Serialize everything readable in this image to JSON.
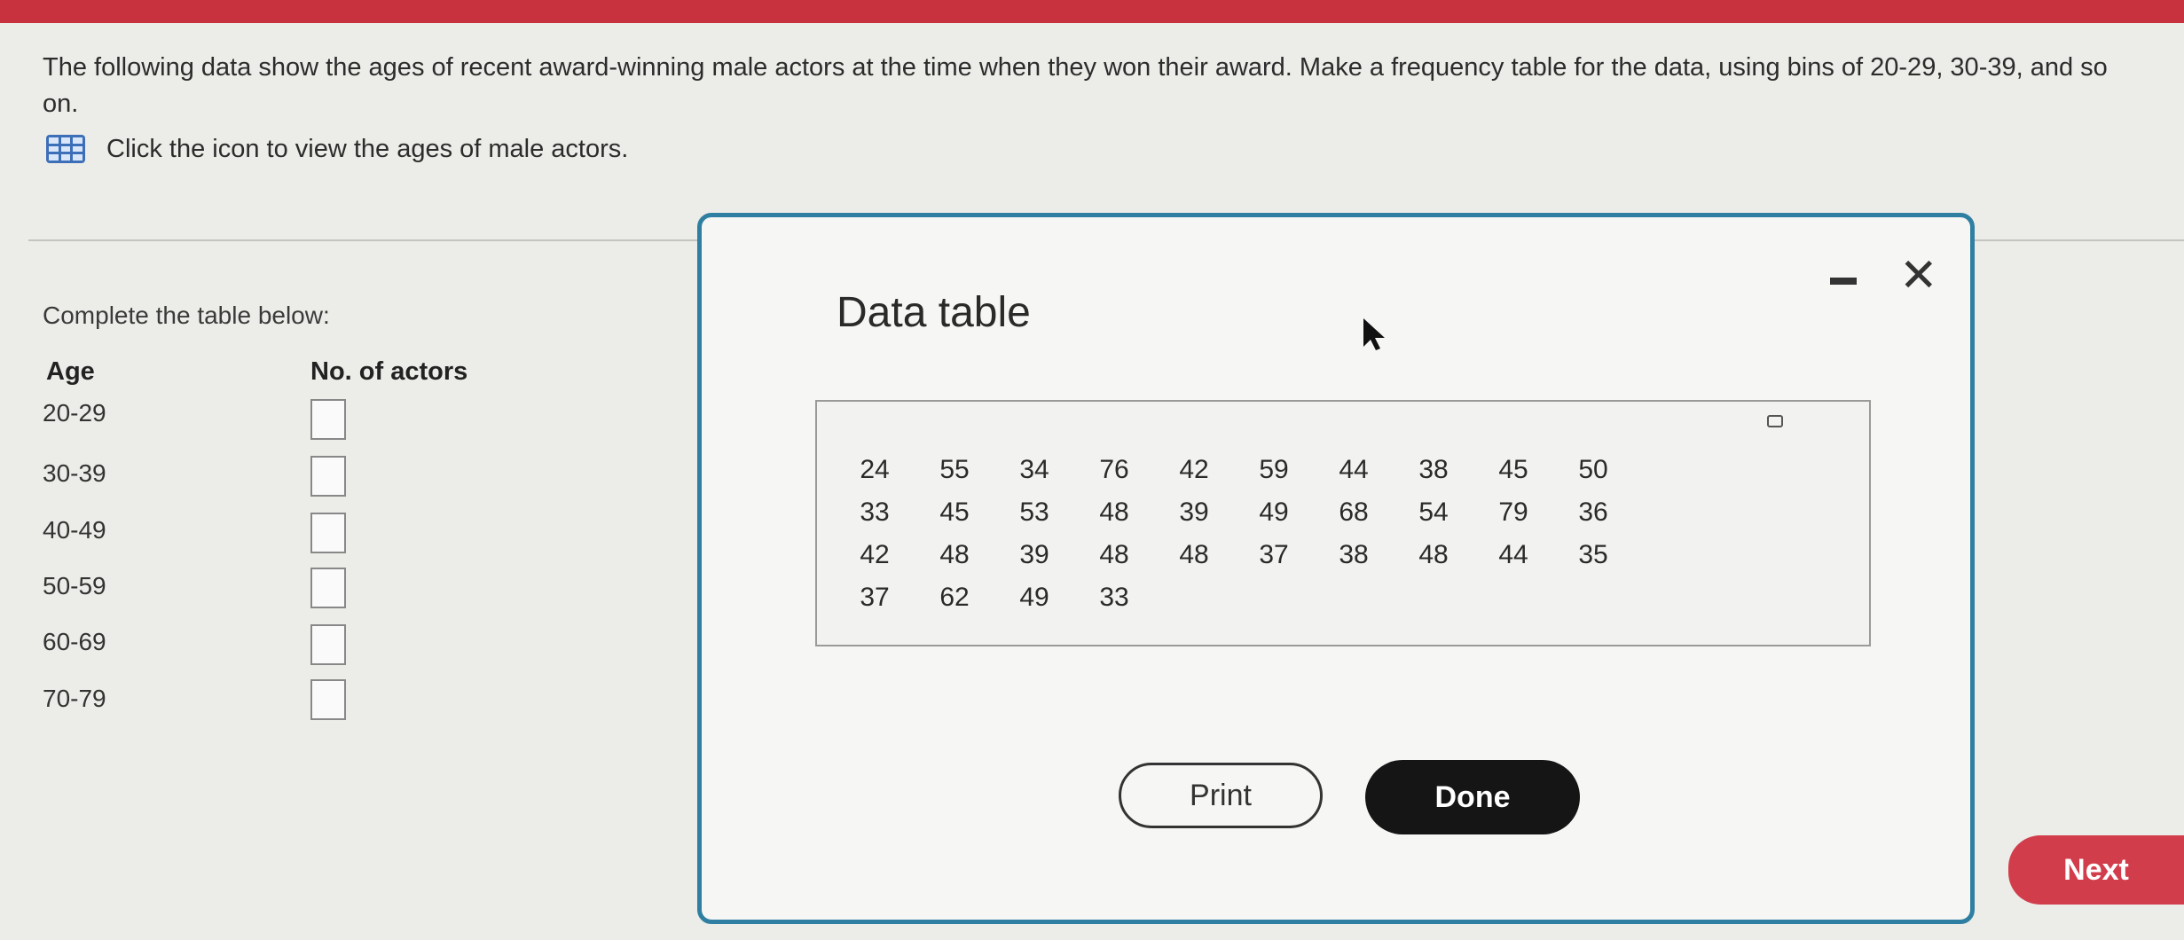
{
  "question": {
    "text": "The following data show the ages of recent award-winning male actors at the time when they won their award. Make a frequency table for the data, using bins of 20-29, 30-39, and so on.",
    "icon_link": "Click the icon to view the ages of male actors.",
    "icon": "table-icon"
  },
  "frequency_table": {
    "instruction": "Complete the table below:",
    "col_age": "Age",
    "col_count": "No. of actors",
    "rows": [
      {
        "age": "20-29",
        "count": ""
      },
      {
        "age": "30-39",
        "count": ""
      },
      {
        "age": "40-49",
        "count": ""
      },
      {
        "age": "50-59",
        "count": ""
      },
      {
        "age": "60-69",
        "count": ""
      },
      {
        "age": "70-79",
        "count": ""
      }
    ]
  },
  "dialog": {
    "title": "Data table",
    "minimize_icon": "minimize-icon",
    "close_icon": "close-icon",
    "rows": [
      [
        "24",
        "55",
        "34",
        "76",
        "42",
        "59",
        "44",
        "38",
        "45",
        "50"
      ],
      [
        "33",
        "45",
        "53",
        "48",
        "39",
        "49",
        "68",
        "54",
        "79",
        "36"
      ],
      [
        "42",
        "48",
        "39",
        "48",
        "48",
        "37",
        "38",
        "48",
        "44",
        "35"
      ],
      [
        "37",
        "62",
        "49",
        "33"
      ]
    ],
    "print_label": "Print",
    "done_label": "Done"
  },
  "footer": {
    "next_label": "Next"
  },
  "colors": {
    "accent_red": "#c8323f",
    "dialog_border": "#2f7fa2",
    "done_bg": "#151515"
  }
}
